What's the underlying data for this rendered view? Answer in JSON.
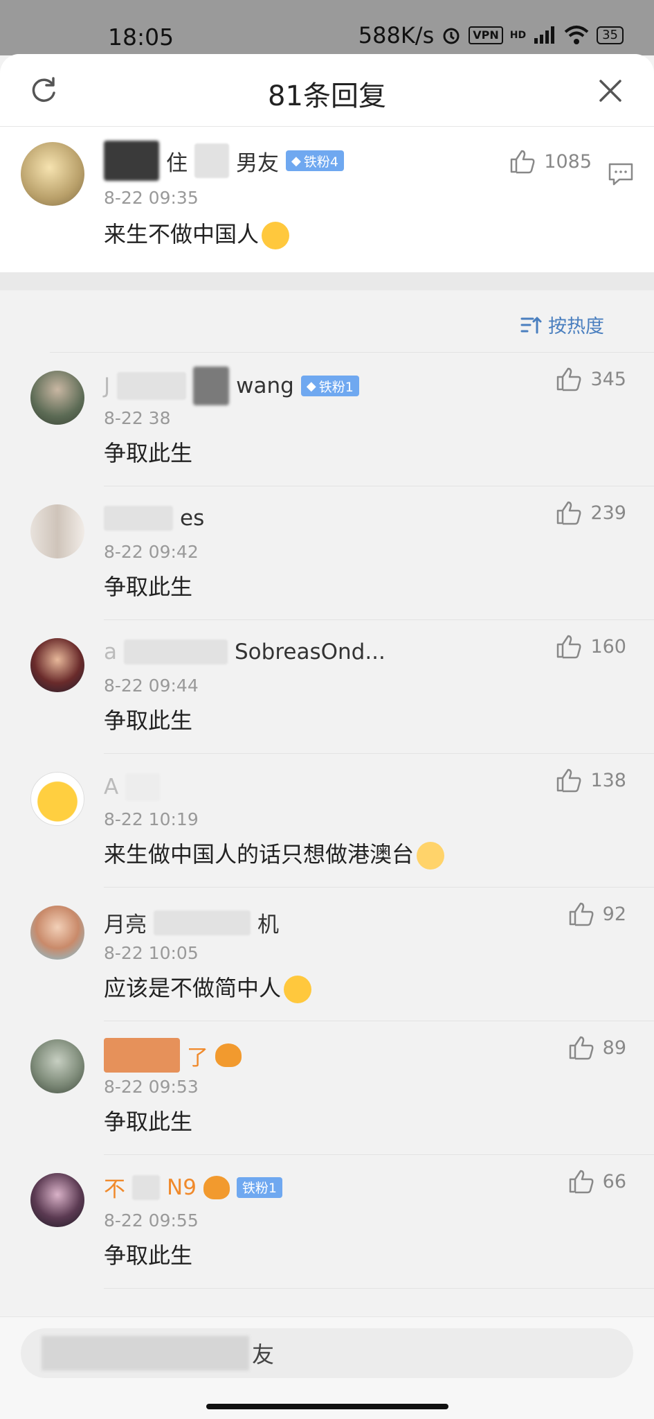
{
  "status_bar": {
    "time": "18:05",
    "net_speed": "588K/s",
    "vpn": "VPN",
    "hd": "HD",
    "battery": "35"
  },
  "header": {
    "title": "81条回复",
    "refresh_icon": "refresh-icon",
    "close_icon": "close-icon"
  },
  "main_comment": {
    "name_visible": "男友",
    "name_partial": "住",
    "badge": "铁粉4",
    "time": "8-22 09:35",
    "content": "来生不做中国人",
    "likes": "1085"
  },
  "sort": {
    "label": "按热度"
  },
  "replies": [
    {
      "name_prefix": "J",
      "name_suffix": "wang",
      "badge": "铁粉1",
      "time": "8-22  38",
      "content": "争取此生",
      "likes": "345"
    },
    {
      "name_prefix": "",
      "name_suffix": "es",
      "badge": "",
      "time": "8-22 09:42",
      "content": "争取此生",
      "likes": "239"
    },
    {
      "name_prefix": "a",
      "name_suffix": "SobreasOnd...",
      "badge": "",
      "time": "8-22 09:44",
      "content": "争取此生",
      "likes": "160"
    },
    {
      "name_prefix": "A",
      "name_suffix": "",
      "badge": "",
      "time": "8-22 10:19",
      "content": "来生做中国人的话只想做港澳台",
      "likes": "138"
    },
    {
      "name_prefix": "月亮",
      "name_suffix": "机",
      "badge": "",
      "time": "8-22 10:05",
      "content": "应该是不做简中人",
      "likes": "92"
    },
    {
      "name_prefix": "",
      "name_suffix": "了",
      "badge": "",
      "time": "8-22 09:53",
      "content": "争取此生",
      "likes": "89"
    },
    {
      "name_prefix": "不",
      "name_suffix": "N9",
      "badge": "铁粉1",
      "time": "8-22 09:55",
      "content": "争取此生",
      "likes": "66"
    }
  ],
  "input": {
    "placeholder_suffix": "友"
  },
  "colors": {
    "accent_blue": "#4a7fbf",
    "badge_blue": "#6fa8f0",
    "vip_orange": "#f08a2c"
  }
}
